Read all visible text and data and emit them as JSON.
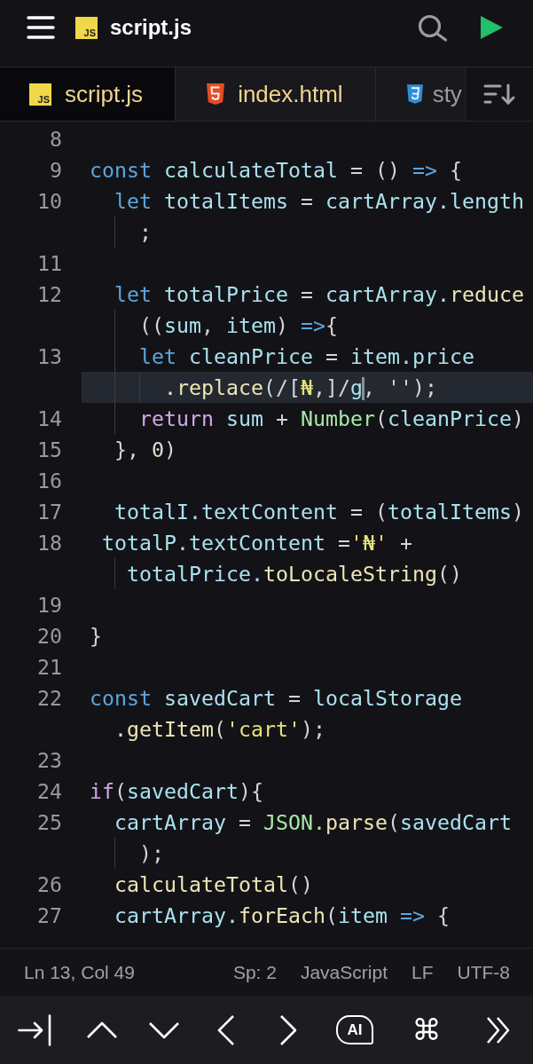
{
  "header": {
    "icon_text": "JS",
    "title": "script.js"
  },
  "tabs": [
    {
      "kind": "js",
      "icon_text": "JS",
      "label": "script.js",
      "selected": true,
      "modified": true
    },
    {
      "kind": "html",
      "label": "index.html",
      "selected": false,
      "modified": true
    },
    {
      "kind": "css",
      "label": "sty",
      "selected": false,
      "modified": false
    }
  ],
  "code": {
    "lines": [
      {
        "number": "8"
      },
      {
        "number": "9",
        "rows": [
          {
            "current": false,
            "tokens": [
              {
                "text": "const",
                "kind": "keyword"
              },
              {
                "text": " calculateTotal",
                "kind": "variable"
              },
              {
                "text": " = () ",
                "kind": "punctuation"
              },
              {
                "text": "=>",
                "kind": "keyword"
              },
              {
                "text": " {",
                "kind": "punctuation"
              }
            ]
          }
        ]
      },
      {
        "number": "10",
        "rows": [
          {
            "current": false,
            "tokens": [
              {
                "text": "  let",
                "kind": "keyword"
              },
              {
                "text": " totalItems",
                "kind": "variable"
              },
              {
                "text": " = ",
                "kind": "punctuation"
              },
              {
                "text": "cartArray.length",
                "kind": "variable"
              }
            ]
          },
          {
            "current": false,
            "tokens": [
              {
                "text": "    ;",
                "kind": "punctuation"
              }
            ]
          }
        ]
      },
      {
        "number": "11"
      },
      {
        "number": "12",
        "rows": [
          {
            "current": false,
            "tokens": [
              {
                "text": "  let",
                "kind": "keyword"
              },
              {
                "text": " totalPrice",
                "kind": "variable"
              },
              {
                "text": " = ",
                "kind": "punctuation"
              },
              {
                "text": "cartArray.",
                "kind": "variable"
              },
              {
                "text": "reduce",
                "kind": "function"
              }
            ]
          },
          {
            "current": false,
            "tokens": [
              {
                "text": "    ((",
                "kind": "punctuation"
              },
              {
                "text": "sum",
                "kind": "variable"
              },
              {
                "text": ", ",
                "kind": "punctuation"
              },
              {
                "text": "item",
                "kind": "variable"
              },
              {
                "text": ") ",
                "kind": "punctuation"
              },
              {
                "text": "=>",
                "kind": "keyword"
              },
              {
                "text": "{",
                "kind": "punctuation"
              }
            ]
          }
        ]
      },
      {
        "number": "13",
        "rows": [
          {
            "current": false,
            "tokens": [
              {
                "text": "    let",
                "kind": "keyword"
              },
              {
                "text": " cleanPrice",
                "kind": "variable"
              },
              {
                "text": " = ",
                "kind": "punctuation"
              },
              {
                "text": "item.price",
                "kind": "variable"
              }
            ]
          },
          {
            "current": true,
            "tokens": [
              {
                "text": "      .replace",
                "kind": "function"
              },
              {
                "text": "(/[",
                "kind": "punctuation"
              },
              {
                "text": "₦",
                "kind": "string"
              },
              {
                "text": ",]/",
                "kind": "punctuation"
              },
              {
                "text": "g",
                "kind": "variable"
              },
              {
                "kind": "cursor"
              },
              {
                "text": ", '');",
                "kind": "punctuation"
              }
            ]
          }
        ]
      },
      {
        "number": "14",
        "rows": [
          {
            "current": false,
            "tokens": [
              {
                "text": "    return",
                "kind": "control"
              },
              {
                "text": " sum",
                "kind": "variable"
              },
              {
                "text": " + ",
                "kind": "punctuation"
              },
              {
                "text": "Number",
                "kind": "class"
              },
              {
                "text": "(",
                "kind": "punctuation"
              },
              {
                "text": "cleanPrice",
                "kind": "variable"
              },
              {
                "text": ")",
                "kind": "punctuation"
              }
            ]
          }
        ]
      },
      {
        "number": "15",
        "rows": [
          {
            "current": false,
            "tokens": [
              {
                "text": "  }, ",
                "kind": "punctuation"
              },
              {
                "text": "0",
                "kind": "number"
              },
              {
                "text": ")",
                "kind": "punctuation"
              }
            ]
          }
        ]
      },
      {
        "number": "16"
      },
      {
        "number": "17",
        "rows": [
          {
            "current": false,
            "tokens": [
              {
                "text": "  totalI.textContent",
                "kind": "variable"
              },
              {
                "text": " = (",
                "kind": "punctuation"
              },
              {
                "text": "totalItems",
                "kind": "variable"
              },
              {
                "text": ")",
                "kind": "punctuation"
              }
            ]
          }
        ]
      },
      {
        "number": "18",
        "rows": [
          {
            "current": false,
            "tokens": [
              {
                "text": " totalP.textContent",
                "kind": "variable"
              },
              {
                "text": " =",
                "kind": "punctuation"
              },
              {
                "text": "'₦'",
                "kind": "string"
              },
              {
                "text": " +",
                "kind": "punctuation"
              }
            ]
          },
          {
            "current": false,
            "tokens": [
              {
                "text": "   totalPrice.",
                "kind": "variable"
              },
              {
                "text": "toLocaleString",
                "kind": "function"
              },
              {
                "text": "()",
                "kind": "punctuation"
              }
            ]
          }
        ]
      },
      {
        "number": "19"
      },
      {
        "number": "20",
        "rows": [
          {
            "current": false,
            "tokens": [
              {
                "text": "}",
                "kind": "punctuation"
              }
            ]
          }
        ]
      },
      {
        "number": "21"
      },
      {
        "number": "22",
        "rows": [
          {
            "current": false,
            "tokens": [
              {
                "text": "const",
                "kind": "keyword"
              },
              {
                "text": " savedCart",
                "kind": "variable"
              },
              {
                "text": " = ",
                "kind": "punctuation"
              },
              {
                "text": "localStorage",
                "kind": "variable"
              }
            ]
          },
          {
            "current": false,
            "tokens": [
              {
                "text": "  .getItem",
                "kind": "function"
              },
              {
                "text": "(",
                "kind": "punctuation"
              },
              {
                "text": "'cart'",
                "kind": "string"
              },
              {
                "text": ");",
                "kind": "punctuation"
              }
            ]
          }
        ]
      },
      {
        "number": "23"
      },
      {
        "number": "24",
        "rows": [
          {
            "current": false,
            "tokens": [
              {
                "text": "if",
                "kind": "control"
              },
              {
                "text": "(",
                "kind": "punctuation"
              },
              {
                "text": "savedCart",
                "kind": "variable"
              },
              {
                "text": "){",
                "kind": "punctuation"
              }
            ]
          }
        ]
      },
      {
        "number": "25",
        "rows": [
          {
            "current": false,
            "tokens": [
              {
                "text": "  cartArray",
                "kind": "variable"
              },
              {
                "text": " = ",
                "kind": "punctuation"
              },
              {
                "text": "JSON.",
                "kind": "class"
              },
              {
                "text": "parse",
                "kind": "function"
              },
              {
                "text": "(",
                "kind": "punctuation"
              },
              {
                "text": "savedCart",
                "kind": "variable"
              }
            ]
          },
          {
            "current": false,
            "tokens": [
              {
                "text": "    );",
                "kind": "punctuation"
              }
            ]
          }
        ]
      },
      {
        "number": "26",
        "rows": [
          {
            "current": false,
            "tokens": [
              {
                "text": "  calculateTotal",
                "kind": "function"
              },
              {
                "text": "()",
                "kind": "punctuation"
              }
            ]
          }
        ]
      },
      {
        "number": "27",
        "rows": [
          {
            "current": false,
            "tokens": [
              {
                "text": "  cartArray.",
                "kind": "variable"
              },
              {
                "text": "forEach",
                "kind": "function"
              },
              {
                "text": "(",
                "kind": "punctuation"
              },
              {
                "text": "item",
                "kind": "variable"
              },
              {
                "text": " =>",
                "kind": "keyword"
              },
              {
                "text": " {",
                "kind": "punctuation"
              }
            ]
          }
        ]
      }
    ]
  },
  "status_bar": {
    "position": "Ln 13, Col 49",
    "indentation": "Sp: 2",
    "language": "JavaScript",
    "line_ending": "LF",
    "encoding": "UTF-8"
  },
  "toolbar": [
    {
      "kind": "tab"
    },
    {
      "kind": "up"
    },
    {
      "kind": "down"
    },
    {
      "kind": "left"
    },
    {
      "kind": "right"
    },
    {
      "kind": "ai",
      "label": "AI"
    },
    {
      "kind": "command",
      "label": "⌘"
    },
    {
      "kind": "more"
    }
  ]
}
